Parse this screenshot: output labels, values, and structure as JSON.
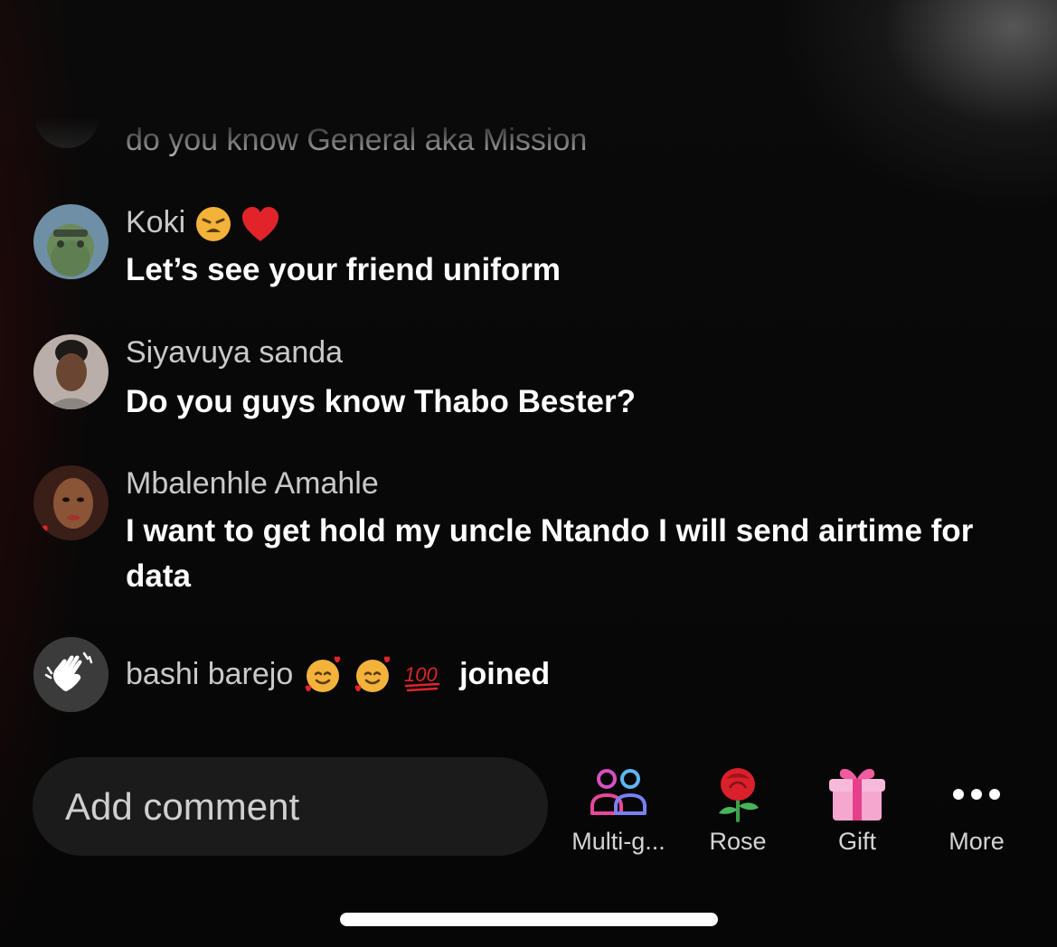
{
  "comments": {
    "faded_text": "do you know General aka Mission",
    "items": [
      {
        "username": "Koki",
        "text": "Let’s see your friend uniform",
        "emojis": [
          "weary-face",
          "red-heart"
        ]
      },
      {
        "username": "Siyavuya sanda",
        "text": "Do you guys know Thabo Bester?"
      },
      {
        "username": "Mbalenhle Amahle",
        "text": "I want to get hold my uncle Ntando I will send airtime for data"
      }
    ],
    "join_event": {
      "username": "bashi barejo",
      "emojis": [
        "smiling-face-with-hearts",
        "smiling-face-with-hearts",
        "hundred-points"
      ],
      "action": "joined"
    }
  },
  "bottom_bar": {
    "comment_placeholder": "Add comment",
    "actions": [
      {
        "label": "Multi-g...",
        "icon": "multi-guest-icon"
      },
      {
        "label": "Rose",
        "icon": "rose-icon"
      },
      {
        "label": "Gift",
        "icon": "gift-icon"
      },
      {
        "label": "More",
        "icon": "more-dots-icon"
      }
    ]
  },
  "colors": {
    "background": "#050505",
    "username_text": "#c9c9c9",
    "comment_text": "#ffffff",
    "input_background": "#1c1b1b"
  }
}
